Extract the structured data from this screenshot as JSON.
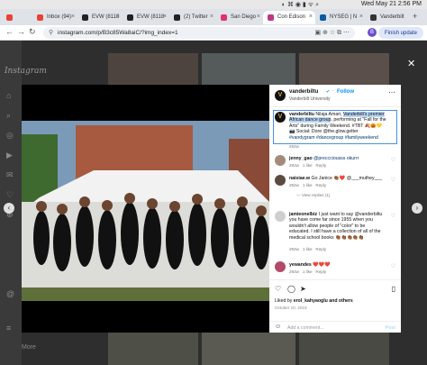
{
  "menubar": {
    "datetime": "Wed May 21  2:56 PM"
  },
  "tabs": [
    {
      "label": "",
      "color": "#e94235"
    },
    {
      "label": "Inbox (94)",
      "color": "#e94235"
    },
    {
      "label": "EVW (8118",
      "color": "#222"
    },
    {
      "label": "EVW (8118",
      "color": "#222"
    },
    {
      "label": "(2) Twitter",
      "color": "#222"
    },
    {
      "label": "San Diego",
      "color": "#e1306c"
    },
    {
      "label": "Con Edison",
      "color": "#c13584"
    },
    {
      "label": "NYSEG | N",
      "color": "#0b5aa2"
    },
    {
      "label": "Vanderbilt",
      "color": "#333"
    }
  ],
  "toolbar": {
    "url": "instagram.com/p/B3c85Wa8aiC/?img_index=1",
    "finish_label": "Finish update",
    "profile_initial": "B"
  },
  "sidebar": {
    "logo": "Instagram",
    "more_label": "More"
  },
  "post": {
    "username": "vanderbiltu",
    "verified": "✔",
    "follow_label": "Follow",
    "location": "Vanderbilt University",
    "caption_user": "vanderbiltu",
    "caption_pre": " Nilaja Amari, ",
    "caption_highlight": "Vanderbilt's premier African dance group",
    "caption_post": ", performing at \"Fall for the Arts\" during Family Weekend. #TBT",
    "caption_line2": " Social: Dore @the.glow.getter",
    "caption_tags": "#vandygram #dancegroup #familyweekend",
    "caption_time": "292w",
    "comments": [
      {
        "user": "jenny_gao",
        "text": "@preccciousss okurrr",
        "time": "292w",
        "likes": "1 like",
        "reply": "Reply",
        "avatar_color": "#a48a7a"
      },
      {
        "user": "naisiae.w",
        "text": "Go Janice 👏🏾❤️ @___muthey___",
        "time": "292w",
        "likes": "1 like",
        "reply": "Reply",
        "view_replies": "View replies (1)",
        "avatar_color": "#5a4a40"
      },
      {
        "user": "jamieonelbiz",
        "text": "I just want to say @vanderbiltu you have come far since 1955 when you wouldn't allow people of \"color\" to be educated. I still have a collection of all of the medical school books 👏🏾👏🏾👏🏾👏🏾👏🏾",
        "time": "292w",
        "likes": "1 like",
        "reply": "Reply",
        "avatar_color": "#cfcfcf"
      },
      {
        "user": "yewandes",
        "text": "❤️❤️❤️",
        "time": "292w",
        "likes": "1 like",
        "reply": "Reply",
        "avatar_color": "#b24a6a"
      }
    ],
    "liked_by_prefix": "Liked by ",
    "liked_by_user": "erol_kahyaoglu",
    "liked_by_suffix": " and others",
    "date": "October 10, 2019",
    "add_comment_placeholder": "Add a comment...",
    "post_label": "Post"
  }
}
